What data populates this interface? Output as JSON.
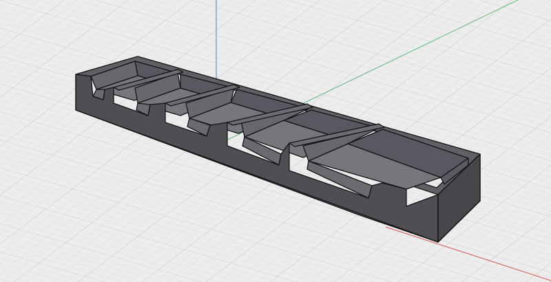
{
  "viewport": {
    "background": "#ededed",
    "grid": {
      "shown": true,
      "minor_color": "#d8d8d8",
      "major_color": "#c2c2c2"
    },
    "axes": {
      "x_axis_color": "#d96a6a",
      "y_axis_color": "#6fbf8a",
      "z_axis_color": "#5b8fd6"
    }
  },
  "model": {
    "shape": "tray-organizer",
    "compartment_count": 5,
    "front_notch_count": 5,
    "colors": {
      "top_face": "#5f5f64",
      "outer_front": "#4e4e53",
      "outer_side": "#46464b",
      "inner_floor": "#76767b",
      "inner_back_wall": "#585860",
      "inner_side_wall": "#67676d",
      "divider_top": "#6c6c71",
      "edge": "#141416"
    }
  }
}
